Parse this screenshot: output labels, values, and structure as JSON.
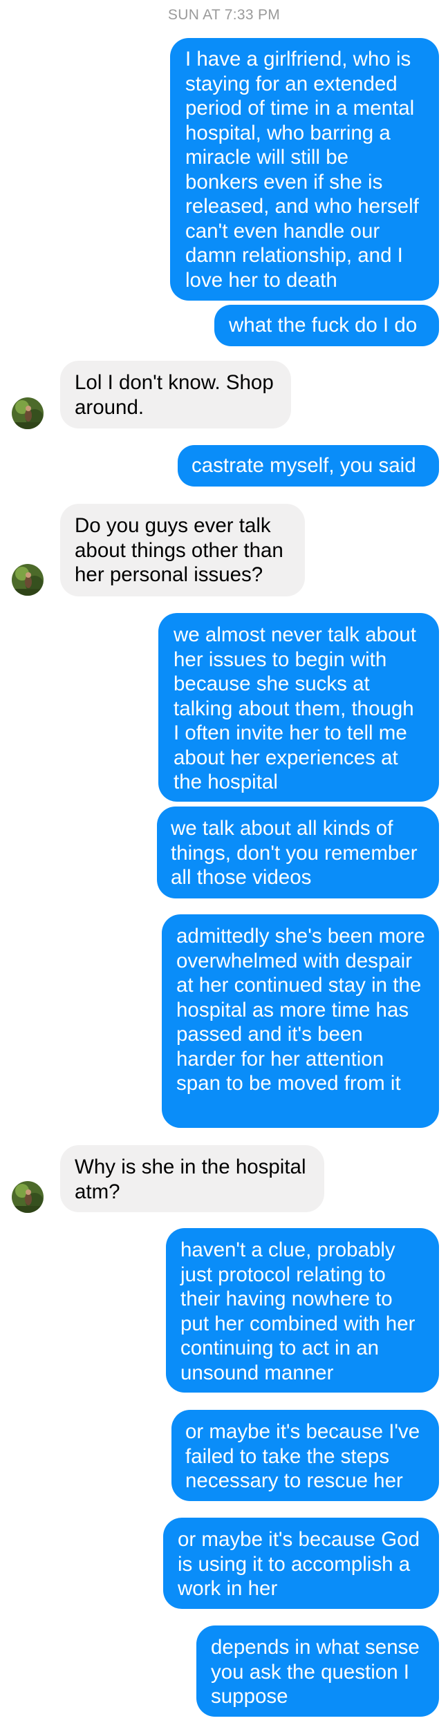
{
  "conversation": {
    "timestamp": "SUN AT 7:33 PM",
    "colors": {
      "sent_bubble": "#0a8df9",
      "received_bubble": "#f1f0f0",
      "sent_text": "#ffffff",
      "received_text": "#000000",
      "timestamp_text": "#9a9a9a"
    },
    "messages": [
      {
        "sender": "me",
        "text": "I have a girlfriend, who is staying for an extended period of time in a mental hospital, who barring a miracle will still be bonkers even if she is released, and who herself can't even handle our damn relationship, and I love her to death"
      },
      {
        "sender": "me",
        "text": "what the fuck do I do"
      },
      {
        "sender": "them",
        "text": "Lol I don't know. Shop around."
      },
      {
        "sender": "me",
        "text": "castrate myself, you said"
      },
      {
        "sender": "them",
        "text": "Do you guys ever talk about things other than her personal issues?"
      },
      {
        "sender": "me",
        "text": "we almost never talk about her issues to begin with because she sucks at talking about them, though I often invite her to tell me about her experiences at the hospital"
      },
      {
        "sender": "me",
        "text": "we talk about all kinds of things, don't you remember all those videos"
      },
      {
        "sender": "me",
        "text": "admittedly she's been more overwhelmed with despair at her continued stay in the hospital as more time has passed and it's been harder for her attention span to be moved from it"
      },
      {
        "sender": "them",
        "text": "Why is she in the hospital atm?"
      },
      {
        "sender": "me",
        "text": "haven't a clue, probably just protocol relating to their having nowhere to put her combined with her continuing to act in an unsound manner"
      },
      {
        "sender": "me",
        "text": "or maybe it's because I've failed to take the steps necessary to rescue her"
      },
      {
        "sender": "me",
        "text": "or maybe it's because God is using it to accomplish a work in her"
      },
      {
        "sender": "me",
        "text": "depends in what sense you ask the question I suppose"
      }
    ]
  }
}
